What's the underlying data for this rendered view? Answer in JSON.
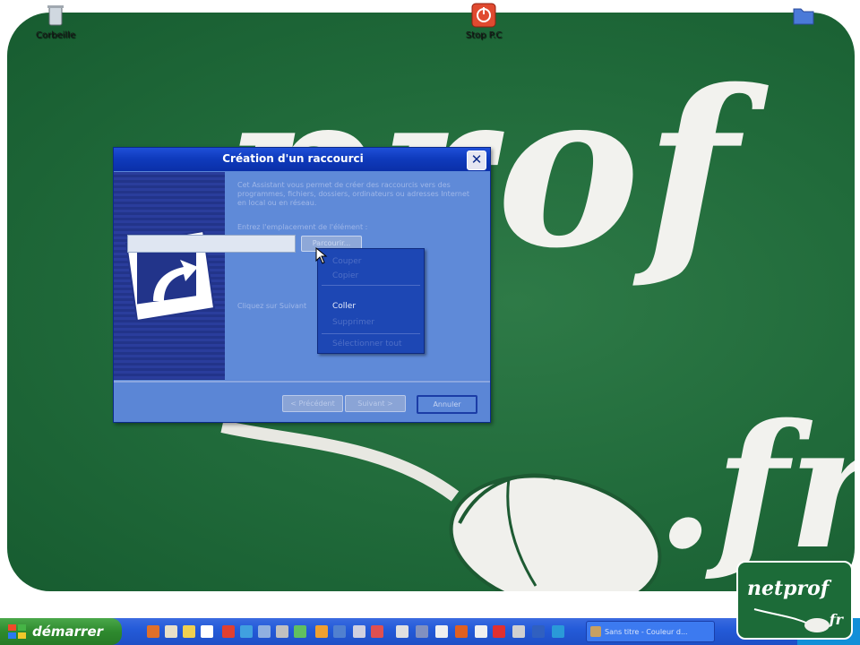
{
  "desktop": {
    "wallpaper": {
      "text_main": "prof",
      "text_suffix": ".fr",
      "color": "#206a3a"
    },
    "icons": [
      {
        "label": "Corbeille",
        "icon": "recycle-bin-icon"
      },
      {
        "label": "Stop P.C",
        "icon": "power-icon"
      },
      {
        "label": "",
        "icon": "folder-icon"
      }
    ]
  },
  "dialog": {
    "title": "Création d'un raccourci",
    "description": "Cet Assistant vous permet de créer des raccourcis vers des programmes, fichiers, dossiers, ordinateurs ou adresses Internet en local ou en réseau.",
    "location_label": "Entrez l'emplacement de l'élément :",
    "location_value": "",
    "browse_label": "Parcourir...",
    "instruction": "Cliquez sur Suivant",
    "buttons": {
      "back": "< Précédent",
      "next": "Suivant >",
      "cancel": "Annuler"
    }
  },
  "context_menu": {
    "items": [
      {
        "label": "Couper",
        "enabled": false
      },
      {
        "label": "Copier",
        "enabled": false
      },
      {
        "label": "Coller",
        "enabled": true
      },
      {
        "label": "Supprimer",
        "enabled": false
      },
      {
        "label": "Sélectionner tout",
        "enabled": false
      }
    ]
  },
  "taskbar": {
    "start_label": "démarrer",
    "task_button": "Sans titre - Couleur d...",
    "colors": {
      "taskbar": "#245bd9",
      "start": "#2e8a2e"
    }
  },
  "logo": {
    "word": "netprof",
    "suffix": ".fr"
  }
}
